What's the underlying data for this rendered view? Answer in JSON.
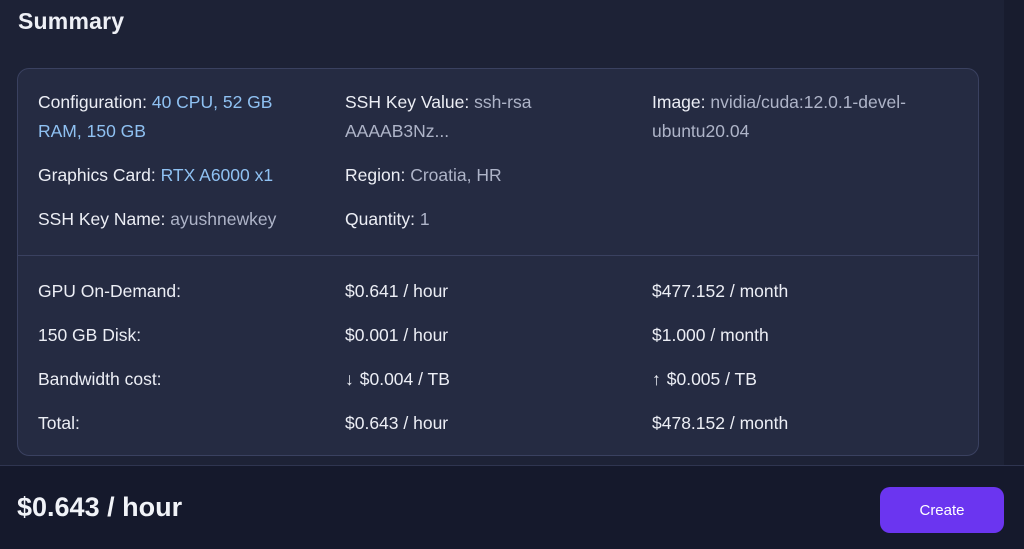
{
  "summary": {
    "title": "Summary",
    "details": {
      "configuration": {
        "label": "Configuration:",
        "value_line1": "40 CPU, 52 GB",
        "value_line2": "RAM, 150 GB"
      },
      "graphics_card": {
        "label": "Graphics Card:",
        "value": "RTX A6000 x1"
      },
      "ssh_key_name": {
        "label": "SSH Key Name:",
        "value": "ayushnewkey"
      },
      "ssh_key_value": {
        "label": "SSH Key Value:",
        "value_line1": "ssh-rsa",
        "value_line2": "AAAAB3Nz..."
      },
      "region": {
        "label": "Region:",
        "value": "Croatia, HR"
      },
      "quantity": {
        "label": "Quantity:",
        "value": "1"
      },
      "image": {
        "label": "Image:",
        "value_line1": "nvidia/cuda:12.0.1-devel-",
        "value_line2": "ubuntu20.04"
      }
    },
    "costs": [
      {
        "label": "GPU On-Demand:",
        "hourly": "$0.641 / hour",
        "monthly": "$477.152 / month"
      },
      {
        "label": "150 GB Disk:",
        "hourly": "$0.001 / hour",
        "monthly": "$1.000 / month"
      },
      {
        "label": "Bandwidth cost:",
        "hourly": "$0.004 / TB",
        "monthly": "$0.005 / TB",
        "hourly_icon": "↓",
        "monthly_icon": "↑"
      },
      {
        "label": "Total:",
        "hourly": "$0.643 / hour",
        "monthly": "$478.152 / month"
      }
    ]
  },
  "footer": {
    "price": "$0.643 / hour",
    "create_label": "Create"
  },
  "colors": {
    "accent": "#6b35f0",
    "highlight": "#8fc1f2",
    "background": "#1d2236",
    "card": "#252b42"
  }
}
